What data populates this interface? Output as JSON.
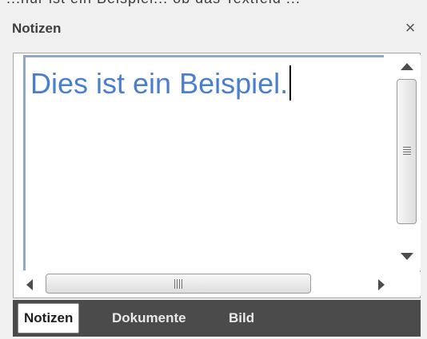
{
  "header": {
    "top_crop_text": "...nur ist ein Beispiel... ob das Textfeld ...",
    "title": "Notizen",
    "close_label": "×"
  },
  "editor": {
    "text": "Dies ist ein Beispiel."
  },
  "scrollbars": {
    "vertical_grip": "≡",
    "horizontal_grip": "|||"
  },
  "tabs": [
    {
      "label": "Notizen",
      "active": true
    },
    {
      "label": "Dokumente",
      "active": false
    },
    {
      "label": "Bild",
      "active": false
    }
  ],
  "colors": {
    "text_blue": "#4a7fcf",
    "tabbar_bg": "#4b4b4b",
    "panel_bg": "#f0f0f0"
  }
}
